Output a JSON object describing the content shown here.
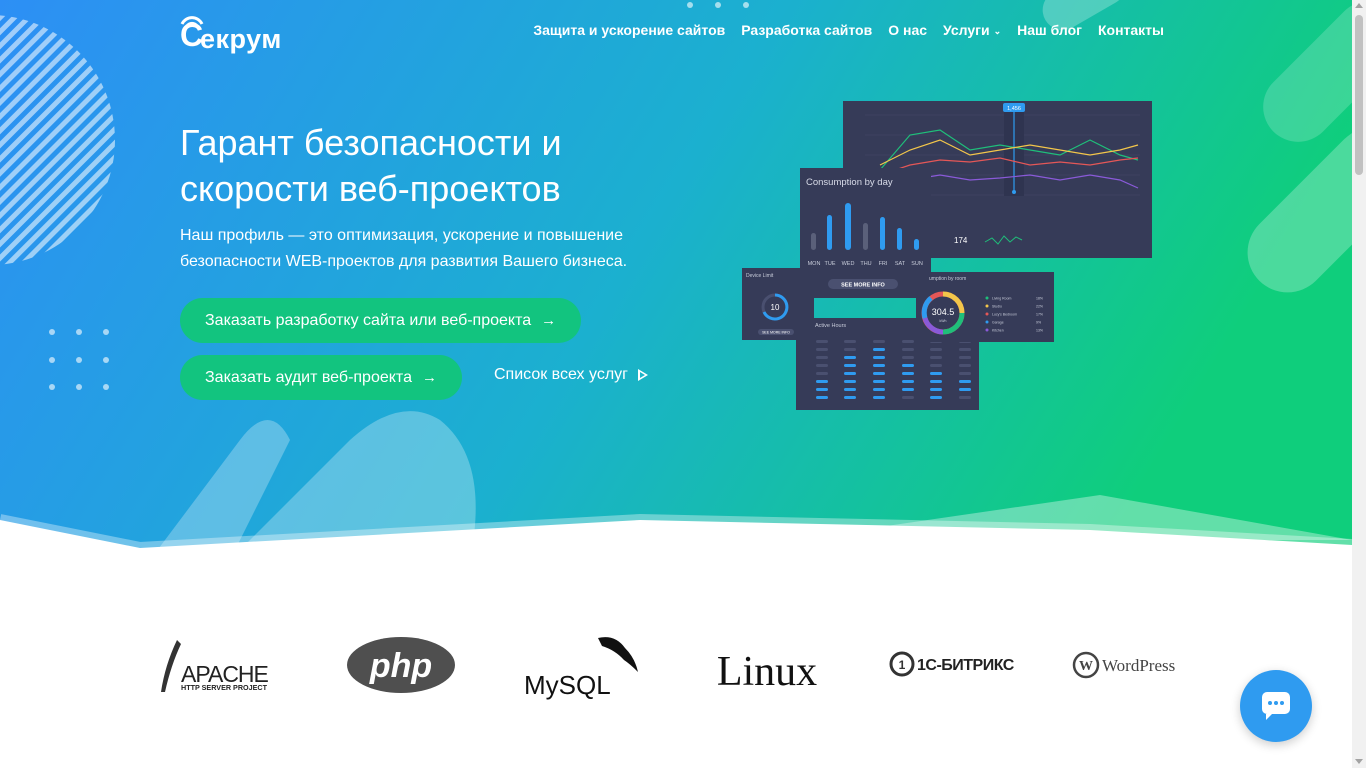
{
  "brand": {
    "name": "Секрум",
    "logo_letter": "С",
    "logo_rest": "екрум"
  },
  "nav": {
    "items": [
      {
        "label": "Защита и ускорение сайтов"
      },
      {
        "label": "Разработка сайтов"
      },
      {
        "label": "О нас"
      },
      {
        "label": "Услуги",
        "has_dropdown": true
      },
      {
        "label": "Наш блог"
      },
      {
        "label": "Контакты"
      }
    ]
  },
  "hero": {
    "title_line1": "Гарант безопасности и",
    "title_line2": "скорости веб-проектов",
    "subtitle_line1": "Наш профиль — это оптимизация, ускорение и повышение",
    "subtitle_line2": "безопасности WEB-проектов для развития Вашего бизнеса.",
    "cta_primary": "Заказать разработку сайта или веб-проекта",
    "cta_secondary": "Заказать аудит веб-проекта",
    "link_all": "Список всех услуг"
  },
  "dashboard": {
    "consumption_title": "Consumption by day",
    "days": [
      "MON",
      "TUE",
      "WED",
      "THU",
      "FRI",
      "SAT",
      "SUN"
    ],
    "see_more": "SEE MORE INFO",
    "device_limit_title": "Device Limit",
    "device_limit_value": "10",
    "device_see_more": "SEE MORE INFO",
    "active_hours_title": "Active Hours",
    "room_title": "umption by room",
    "room_value": "304.5",
    "room_unit": "kWh",
    "room_legend": [
      "Living Room",
      "Studio",
      "Lucy's Bedroom",
      "Garage",
      "Kitchen"
    ],
    "room_pct": [
      "18%",
      "22%",
      "17%",
      "9%",
      "13%"
    ],
    "line_marker": "1,456",
    "big_stat": "174",
    "big_stat_unit": "°"
  },
  "tech_logos": [
    {
      "name": "APACHE",
      "sub": "HTTP SERVER PROJECT"
    },
    {
      "name": "php"
    },
    {
      "name": "MySQL"
    },
    {
      "name": "Linux"
    },
    {
      "name": "1С-БИТРИКС"
    },
    {
      "name": "WordPress"
    }
  ],
  "colors": {
    "grad_start": "#2d8ff5",
    "grad_end": "#0fce7c",
    "button": "#12c47f",
    "chat": "#2f9bf0"
  }
}
